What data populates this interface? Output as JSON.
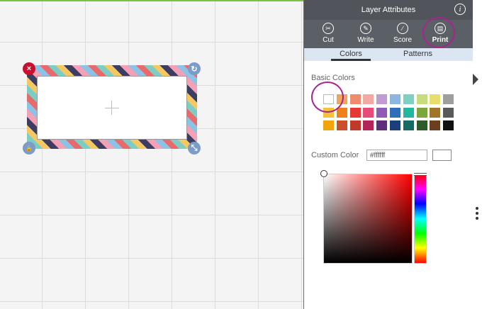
{
  "panel": {
    "title": "Layer Attributes",
    "info_icon": "info-icon",
    "modes": [
      {
        "label": "Cut",
        "icon": "scissors-icon"
      },
      {
        "label": "Write",
        "icon": "pen-icon"
      },
      {
        "label": "Score",
        "icon": "score-icon"
      },
      {
        "label": "Print",
        "icon": "printer-icon"
      }
    ],
    "tabs": [
      {
        "label": "Colors",
        "selected": true
      },
      {
        "label": "Patterns",
        "selected": false
      }
    ],
    "basic_colors_label": "Basic Colors",
    "basic_colors": [
      [
        "#ffffff",
        "#f0a55c",
        "#ef8c6e",
        "#f2a8a4",
        "#c39bd3",
        "#8cb6e0",
        "#7dd0c4",
        "#c6dd7d",
        "#e8dd6d",
        "#9e9e9e"
      ],
      [
        "#f5c23c",
        "#ef7f1a",
        "#e53935",
        "#e84b7a",
        "#8e5bb5",
        "#2f6fb8",
        "#22b8a0",
        "#7ba63a",
        "#a0762a",
        "#5a5a5a"
      ],
      [
        "#f2a40c",
        "#c9502a",
        "#c0392b",
        "#b3245a",
        "#5e2f7a",
        "#1b3f7a",
        "#136b63",
        "#2e5b2a",
        "#6b3e1e",
        "#111111"
      ]
    ],
    "custom_color_label": "Custom Color",
    "custom_color_value": "#ffffff",
    "accent": "#a8258f"
  },
  "canvas": {
    "handles": {
      "delete": {
        "glyph": "×",
        "icon": "close-icon"
      },
      "rotate": {
        "glyph": "↻",
        "icon": "rotate-icon"
      },
      "lock": {
        "glyph": "🔒",
        "icon": "lock-icon"
      },
      "resize": {
        "glyph": "⤡",
        "icon": "resize-icon"
      }
    }
  }
}
